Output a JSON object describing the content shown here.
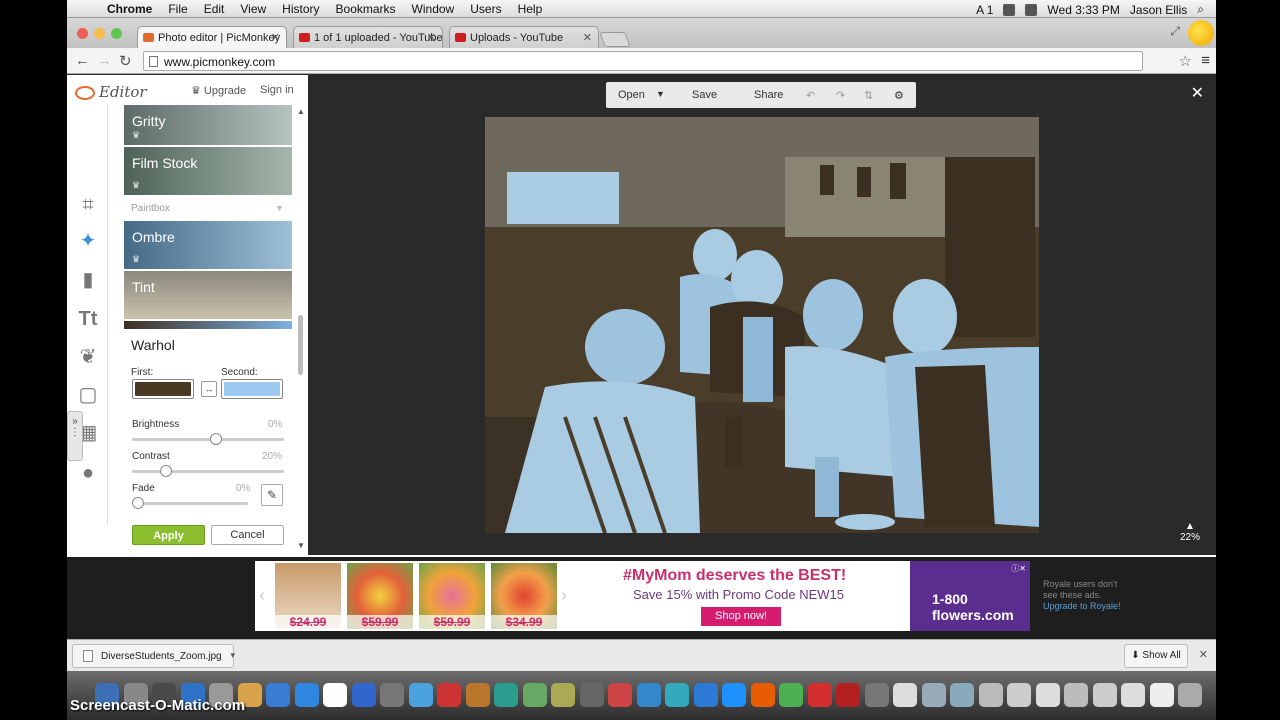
{
  "menubar": {
    "app": "Chrome",
    "items": [
      "File",
      "Edit",
      "View",
      "History",
      "Bookmarks",
      "Window",
      "Users",
      "Help"
    ],
    "clock": "Wed 3:33 PM",
    "user": "Jason Ellis",
    "status_a1": "A 1"
  },
  "tabs": [
    {
      "label": "Photo editor | PicMonkey",
      "favicon_color": "#e06a2f",
      "active": true
    },
    {
      "label": "1 of 1 uploaded - YouTube",
      "favicon_color": "#cc1e1e",
      "active": false
    },
    {
      "label": "Uploads - YouTube",
      "favicon_color": "#cc1e1e",
      "active": false
    }
  ],
  "toolbar": {
    "url": "www.picmonkey.com"
  },
  "editor": {
    "logo": "Editor",
    "upgrade": "Upgrade",
    "signin": "Sign in",
    "effects": [
      {
        "label": "Gritty",
        "color": "#7c8a86"
      },
      {
        "label": "Film Stock",
        "color": "#6f8177"
      },
      {
        "label": "Ombre",
        "color": "#5b7d96"
      },
      {
        "label": "Tint",
        "color": "#8c8a7c"
      }
    ],
    "section": "Paintbox",
    "panel_title": "Warhol",
    "first_label": "First:",
    "second_label": "Second:",
    "first_color": "#4a3a24",
    "second_color": "#9cc9ef",
    "brightness_label": "Brightness",
    "brightness_value": "0%",
    "brightness": 0.56,
    "contrast_label": "Contrast",
    "contrast_value": "20%",
    "contrast": 0.2,
    "fade_label": "Fade",
    "fade_value": "0%",
    "fade": 0.0,
    "apply": "Apply",
    "cancel": "Cancel"
  },
  "topbar": {
    "open": "Open",
    "save": "Save",
    "share": "Share"
  },
  "zoom": "22%",
  "ad": {
    "prices": [
      "$24.99",
      "$59.99",
      "$59.99",
      "$34.99"
    ],
    "headline": "#MyMom deserves the BEST!",
    "subline": "Save 15% with Promo Code NEW15",
    "button": "Shop now!",
    "brand": "1-800 flowers.com",
    "note_line1": "Royale users don't",
    "note_line2": "see these ads.",
    "note_link": "Upgrade to Royale!"
  },
  "downloads": {
    "file": "DiverseStudents_Zoom.jpg",
    "show_all": "Show All"
  },
  "watermark": "Screencast-O-Matic.com"
}
